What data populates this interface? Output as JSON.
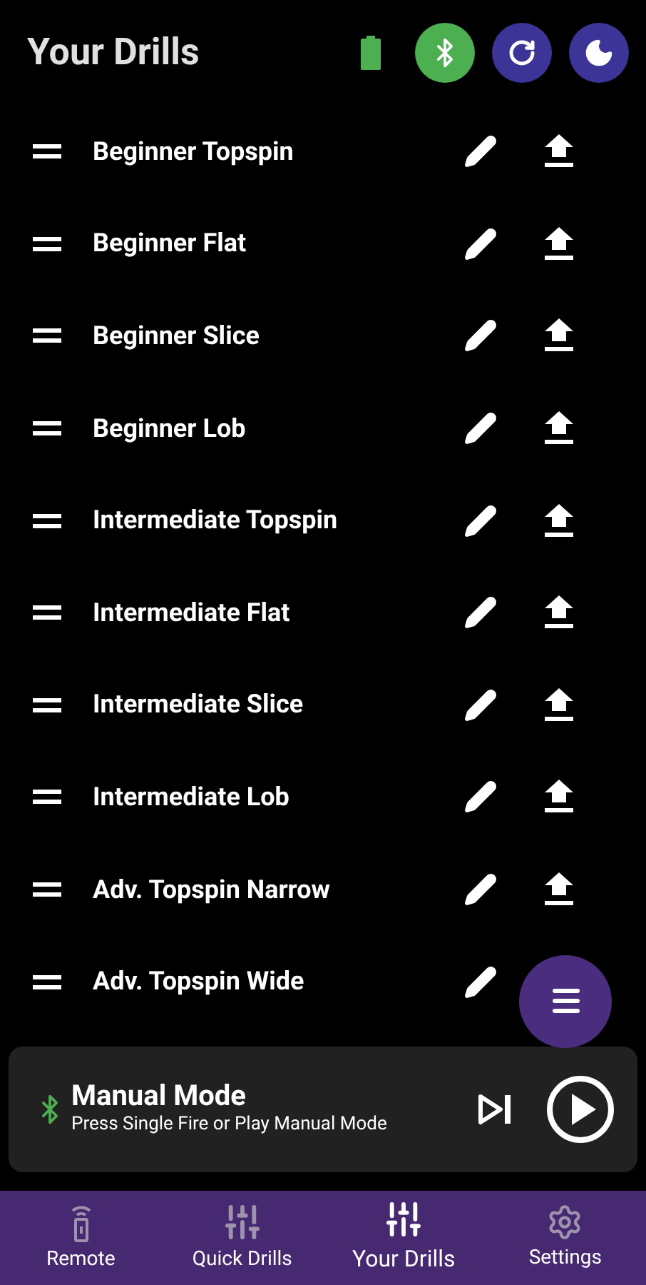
{
  "header": {
    "title": "Your Drills"
  },
  "drills": [
    {
      "name": "Beginner Topspin"
    },
    {
      "name": "Beginner Flat"
    },
    {
      "name": "Beginner Slice"
    },
    {
      "name": "Beginner Lob"
    },
    {
      "name": "Intermediate Topspin"
    },
    {
      "name": "Intermediate Flat"
    },
    {
      "name": "Intermediate Slice"
    },
    {
      "name": "Intermediate Lob"
    },
    {
      "name": "Adv. Topspin Narrow"
    },
    {
      "name": "Adv. Topspin Wide"
    }
  ],
  "player": {
    "title": "Manual Mode",
    "subtitle": "Press Single Fire or Play Manual Mode"
  },
  "nav": [
    {
      "label": "Remote",
      "kind": "remote",
      "selected": false
    },
    {
      "label": "Quick Drills",
      "kind": "sliders",
      "selected": false
    },
    {
      "label": "Your Drills",
      "kind": "sliders",
      "selected": true
    },
    {
      "label": "Settings",
      "kind": "gear",
      "selected": false
    }
  ]
}
